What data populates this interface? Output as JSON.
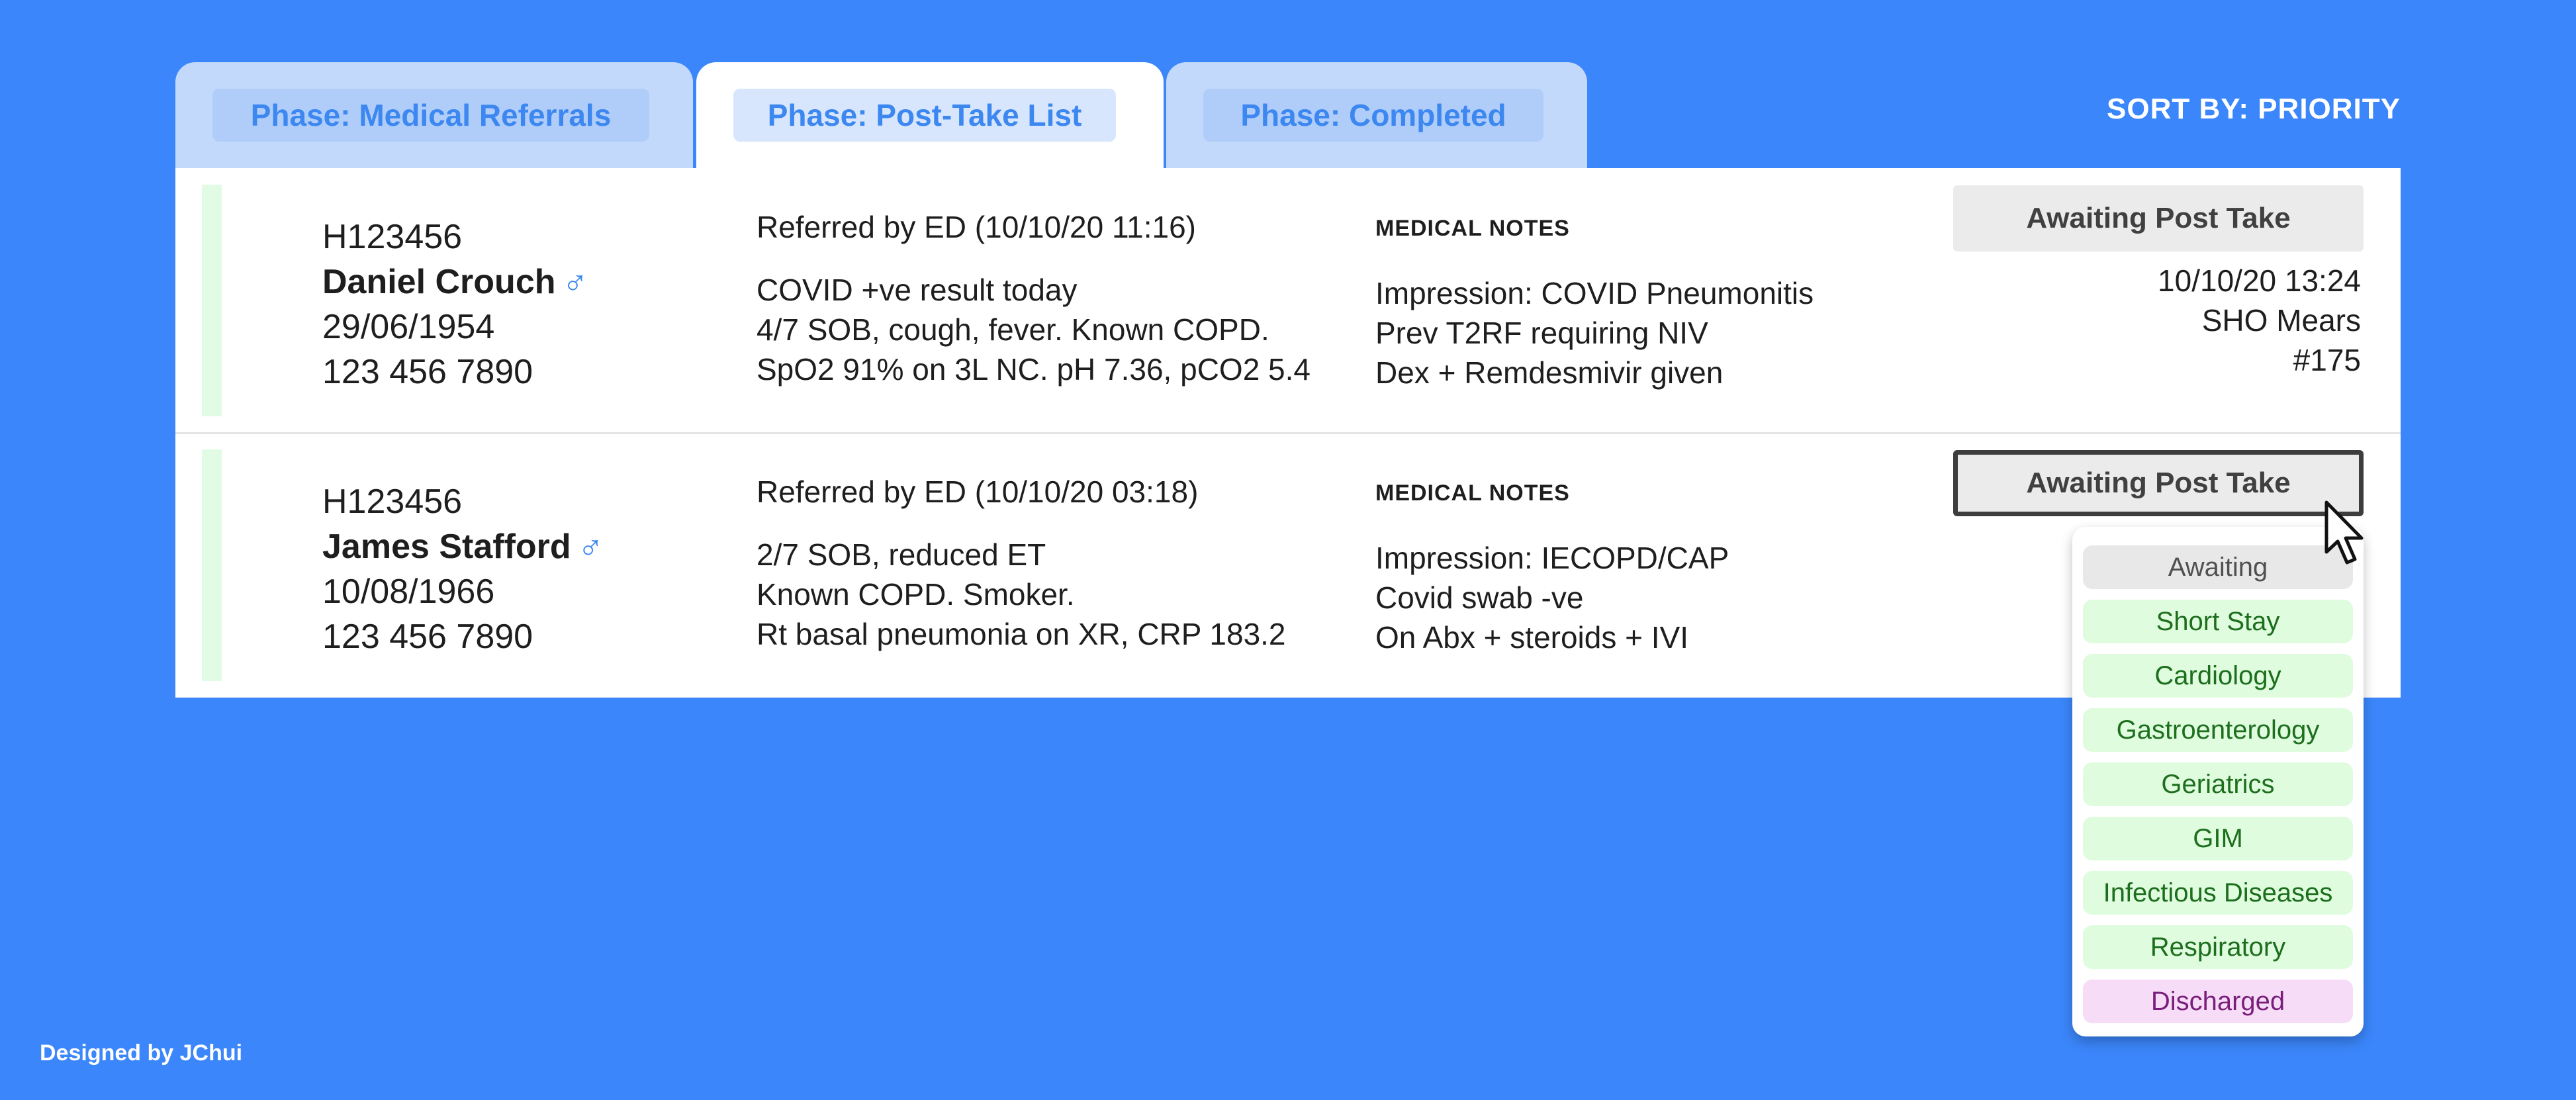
{
  "tabs": [
    {
      "label": "Phase: Medical Referrals",
      "active": false
    },
    {
      "label": "Phase: Post-Take List",
      "active": true
    },
    {
      "label": "Phase: Completed",
      "active": false
    }
  ],
  "sort_label": "SORT BY: PRIORITY",
  "patients": [
    {
      "id": "H123456",
      "name": "Daniel Crouch",
      "sex_icon": "male-icon",
      "sex_glyph": "♂",
      "dob": "29/06/1954",
      "phone": "123 456 7890",
      "referral_title": "Referred by ED (10/10/20 11:16)",
      "referral_lines": [
        "COVID +ve result today",
        "4/7 SOB, cough, fever. Known COPD.",
        "SpO2 91% on 3L NC. pH 7.36, pCO2 5.4"
      ],
      "notes_title": "MEDICAL NOTES",
      "notes_lines": [
        "Impression: COVID Pneumonitis",
        "Prev T2RF requiring NIV",
        "Dex + Remdesmivir given"
      ],
      "status": "Awaiting Post Take",
      "timestamp": "10/10/20 13:24",
      "clinician": "SHO Mears",
      "ref_no": "#175"
    },
    {
      "id": "H123456",
      "name": "James Stafford",
      "sex_icon": "male-icon",
      "sex_glyph": "♂",
      "dob": "10/08/1966",
      "phone": "123 456 7890",
      "referral_title": "Referred by ED (10/10/20 03:18)",
      "referral_lines": [
        "2/7 SOB, reduced ET",
        "Known COPD. Smoker.",
        "Rt basal pneumonia on XR, CRP 183.2"
      ],
      "notes_title": "MEDICAL NOTES",
      "notes_lines": [
        "Impression: IECOPD/CAP",
        "Covid swab -ve",
        "On Abx + steroids + IVI"
      ],
      "status": "Awaiting Post Take"
    }
  ],
  "dropdown_options": [
    {
      "label": "Awaiting",
      "style": "awaiting"
    },
    {
      "label": "Short Stay",
      "style": "green"
    },
    {
      "label": "Cardiology",
      "style": "green"
    },
    {
      "label": "Gastroenterology",
      "style": "green"
    },
    {
      "label": "Geriatrics",
      "style": "green"
    },
    {
      "label": "GIM",
      "style": "green"
    },
    {
      "label": "Infectious Diseases",
      "style": "green"
    },
    {
      "label": "Respiratory",
      "style": "green"
    },
    {
      "label": "Discharged",
      "style": "purple"
    }
  ],
  "colors": {
    "background": "#3b86fb",
    "accent": "#3c87f0",
    "green_option": "#dffcdf",
    "purple_option": "#f6dcf7"
  },
  "footer": "Designed by JChui"
}
